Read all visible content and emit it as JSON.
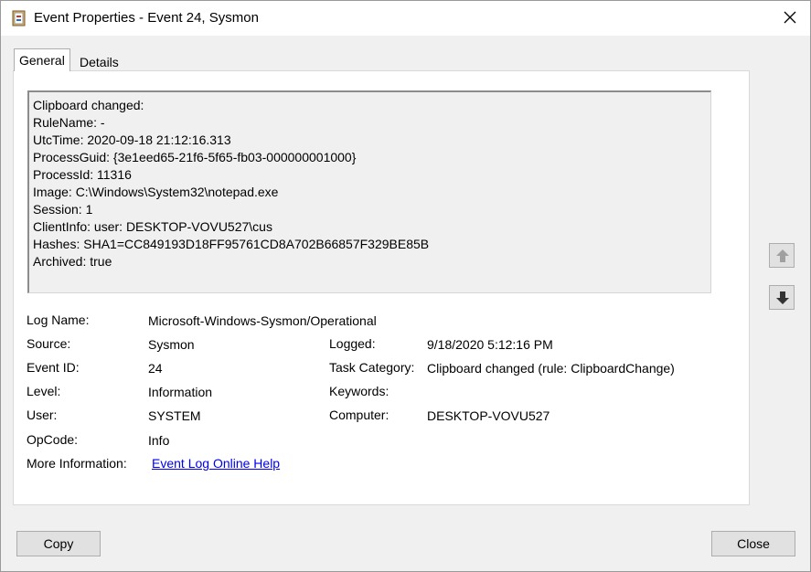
{
  "window": {
    "title": "Event Properties - Event 24, Sysmon"
  },
  "tabs": [
    {
      "label": "General"
    },
    {
      "label": "Details"
    }
  ],
  "description": [
    "Clipboard changed:",
    "RuleName: -",
    "UtcTime: 2020-09-18 21:12:16.313",
    "ProcessGuid: {3e1eed65-21f6-5f65-fb03-000000001000}",
    "ProcessId: 11316",
    "Image: C:\\Windows\\System32\\notepad.exe",
    "Session: 1",
    "ClientInfo: user: DESKTOP-VOVU527\\cus",
    "Hashes: SHA1=CC849193D18FF95761CD8A702B66857F329BE85B",
    "Archived: true"
  ],
  "fields": {
    "log_name": {
      "label": "Log Name:",
      "value": "Microsoft-Windows-Sysmon/Operational"
    },
    "source": {
      "label": "Source:",
      "value": "Sysmon"
    },
    "logged": {
      "label": "Logged:",
      "value": "9/18/2020 5:12:16 PM"
    },
    "event_id": {
      "label": "Event ID:",
      "value": "24"
    },
    "task_category": {
      "label": "Task Category:",
      "value": "Clipboard changed (rule: ClipboardChange)"
    },
    "level": {
      "label": "Level:",
      "value": "Information"
    },
    "keywords": {
      "label": "Keywords:",
      "value": ""
    },
    "user": {
      "label": "User:",
      "value": "SYSTEM"
    },
    "computer": {
      "label": "Computer:",
      "value": "DESKTOP-VOVU527"
    },
    "opcode": {
      "label": "OpCode:",
      "value": "Info"
    },
    "more_info": {
      "label": "More Information:",
      "link": "Event Log Online Help"
    }
  },
  "buttons": {
    "copy": "Copy",
    "close": "Close"
  },
  "colors": {
    "link": "#0000ee",
    "panel": "#ffffff",
    "chrome": "#f0f0f0"
  }
}
